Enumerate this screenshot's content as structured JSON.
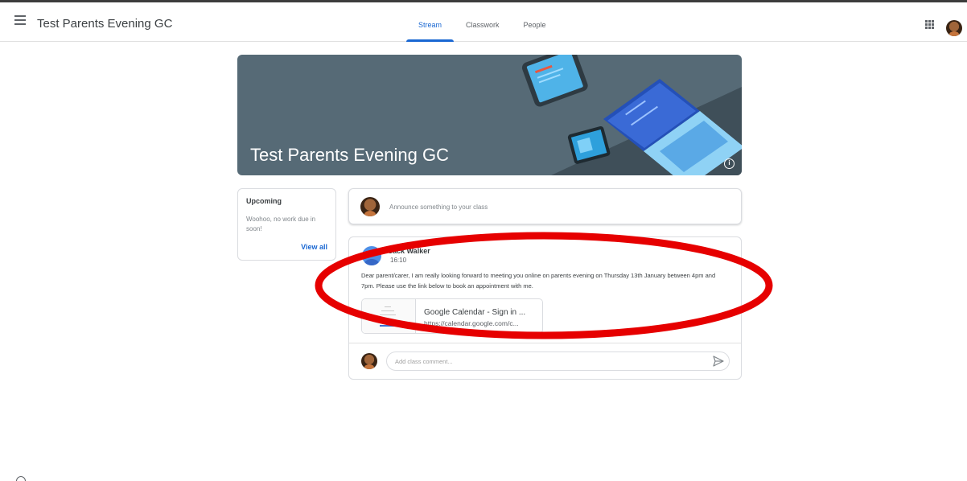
{
  "header": {
    "class_title": "Test Parents Evening GC",
    "tabs": [
      {
        "label": "Stream",
        "active": true
      },
      {
        "label": "Classwork",
        "active": false
      },
      {
        "label": "People",
        "active": false
      }
    ]
  },
  "banner": {
    "title": "Test Parents Evening GC",
    "info_glyph": "i"
  },
  "upcoming": {
    "title": "Upcoming",
    "text": "Woohoo, no work due in soon!",
    "view_all": "View all"
  },
  "announce": {
    "placeholder": "Announce something to your class"
  },
  "post": {
    "author": "Jack Walker",
    "time": "16:10",
    "body": "Dear parent/carer, I am really looking forward to meeting you online on parents evening on Thursday 13th January between 4pm and 7pm. Please use the link below to book an appointment with me.",
    "attachment": {
      "title": "Google Calendar - Sign in ...",
      "url": "https://calendar.google.com/c..."
    },
    "comment_placeholder": "Add class comment..."
  },
  "colors": {
    "accent": "#1967d2",
    "banner": "#566a76",
    "annotation": "#e60000"
  }
}
